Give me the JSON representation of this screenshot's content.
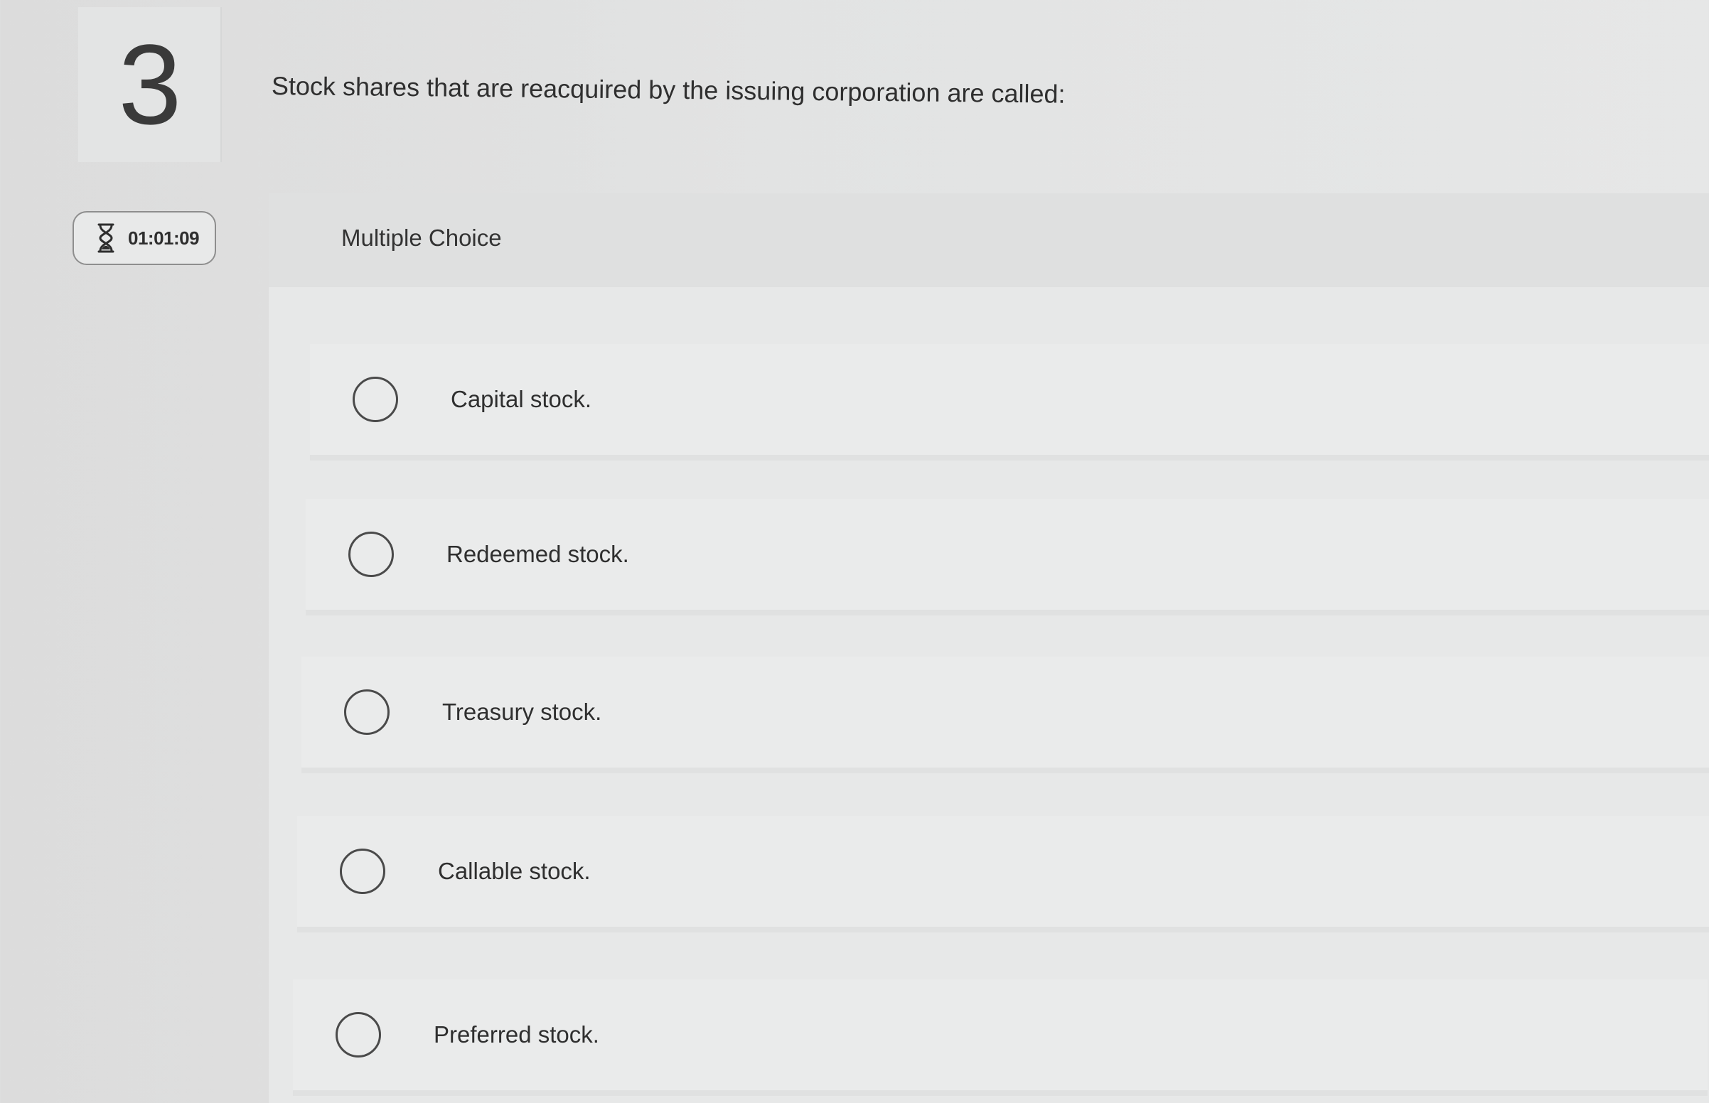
{
  "question": {
    "number": "3",
    "text": "Stock shares that are reacquired by the issuing corporation are called:",
    "type": "Multiple Choice"
  },
  "timer": {
    "icon": "hourglass-icon",
    "value": "01:01:09"
  },
  "choices": [
    {
      "label": "Capital stock.",
      "selected": false
    },
    {
      "label": "Redeemed stock.",
      "selected": false
    },
    {
      "label": "Treasury stock.",
      "selected": false
    },
    {
      "label": "Callable stock.",
      "selected": false
    },
    {
      "label": "Preferred stock.",
      "selected": false
    }
  ],
  "colors": {
    "background": "#e2e3e3",
    "panel": "#e7e8e8",
    "text": "#2f2f2f",
    "radio_border": "#4a4a4a"
  }
}
